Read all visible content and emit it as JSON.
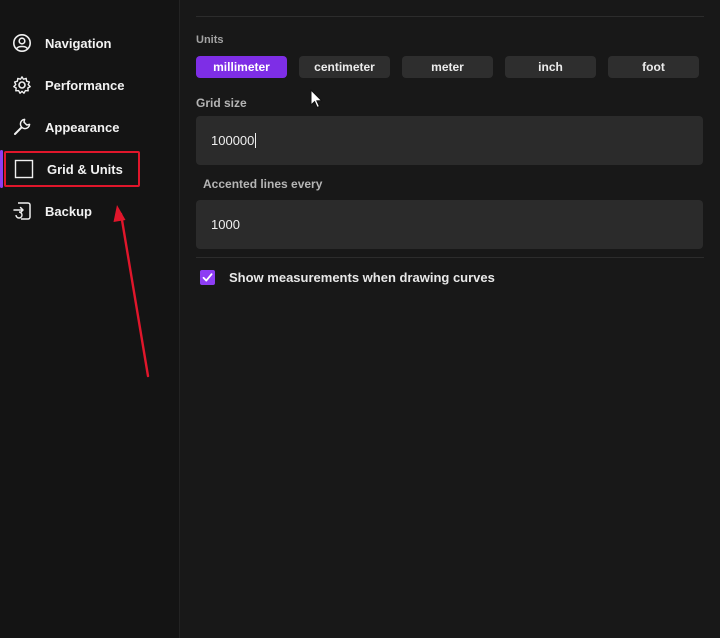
{
  "sidebar": {
    "items": [
      {
        "label": "Navigation",
        "icon": "person-circle-icon"
      },
      {
        "label": "Performance",
        "icon": "gear-icon"
      },
      {
        "label": "Appearance",
        "icon": "wrench-icon"
      },
      {
        "label": "Grid & Units",
        "icon": "square-icon",
        "active": true
      },
      {
        "label": "Backup",
        "icon": "backup-icon"
      }
    ]
  },
  "units": {
    "label": "Units",
    "options": [
      "millimeter",
      "centimeter",
      "meter",
      "inch",
      "foot"
    ],
    "selected": "millimeter"
  },
  "grid_size": {
    "label": "Grid size",
    "value": "100000"
  },
  "accented_lines": {
    "label": "Accented lines every",
    "value": "1000"
  },
  "show_measurements": {
    "label": "Show measurements when drawing curves",
    "checked": true
  },
  "colors": {
    "accent": "#8d3df4",
    "selected_unit": "#7e2ee6",
    "annotation": "#e0162b"
  }
}
